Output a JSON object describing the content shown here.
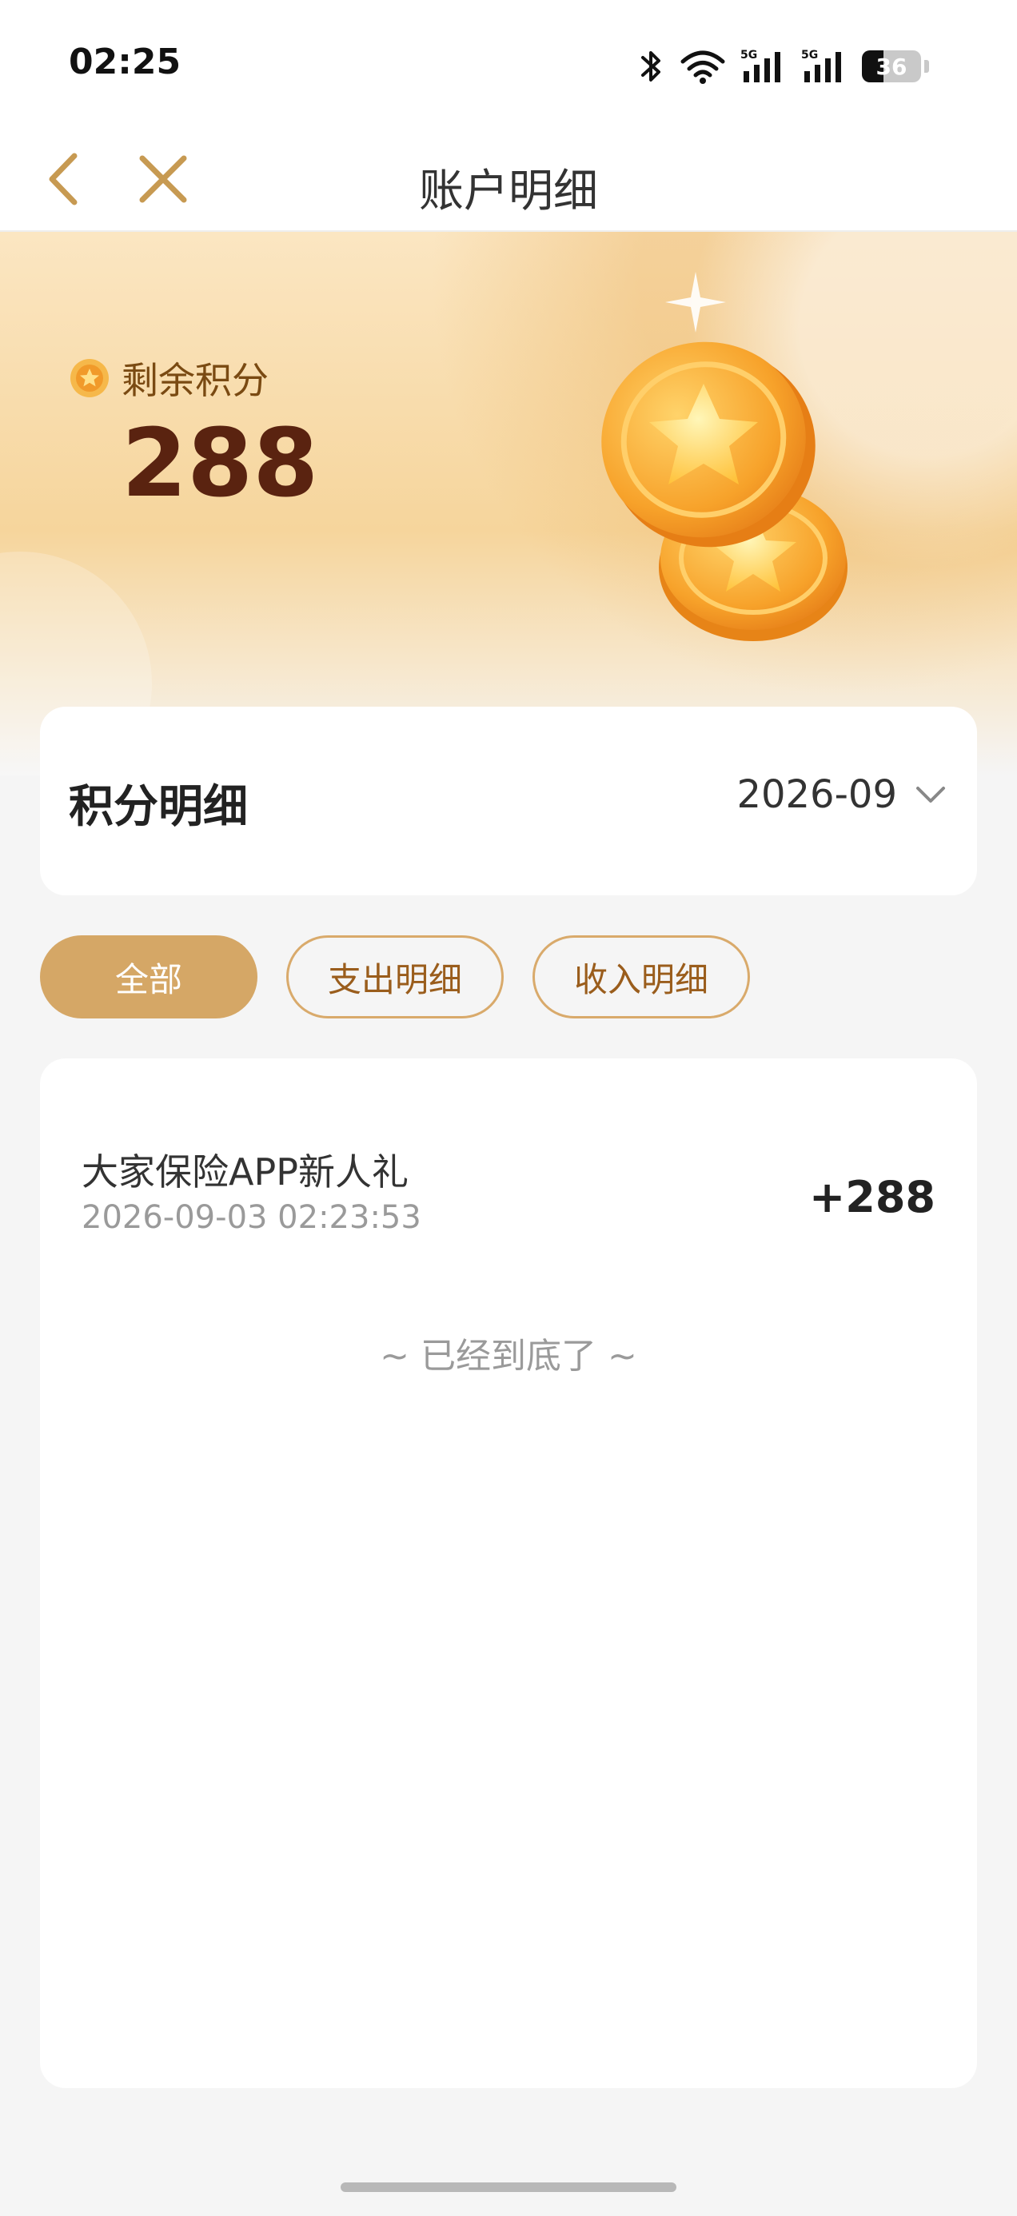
{
  "status_bar": {
    "time": "02:25",
    "battery": "36",
    "icons": [
      "bluetooth-icon",
      "wifi-icon",
      "signal-5g-icon",
      "signal-5g-icon",
      "battery-icon"
    ]
  },
  "nav": {
    "title": "账户明细",
    "back_icon": "chevron-left-icon",
    "close_icon": "close-icon"
  },
  "banner": {
    "label": "剩余积分",
    "value": "288"
  },
  "detail": {
    "title": "积分明细",
    "month": "2026-09"
  },
  "tabs": [
    {
      "label": "全部",
      "active": true
    },
    {
      "label": "支出明细",
      "active": false
    },
    {
      "label": "收入明细",
      "active": false
    }
  ],
  "records": [
    {
      "title": "大家保险APP新人礼",
      "time": "2026-09-03 02:23:53",
      "amount": "+288"
    }
  ],
  "list_end": "~ 已经到底了 ~",
  "colors": {
    "accent": "#d5a766",
    "accent_text": "#9a5d1c",
    "value_text": "#5a2310"
  }
}
